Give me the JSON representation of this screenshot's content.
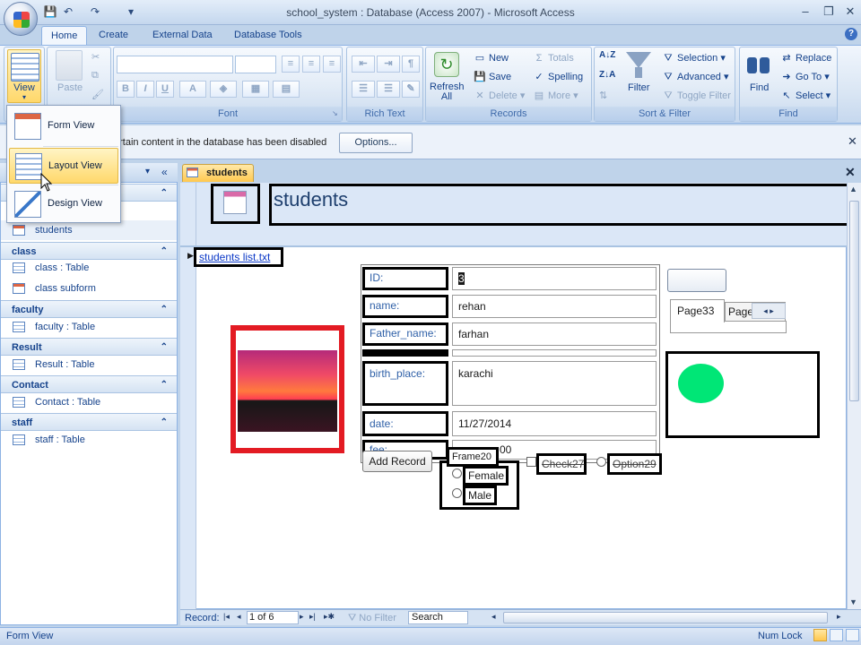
{
  "window": {
    "title": "school_system : Database (Access 2007) - Microsoft Access",
    "controls": [
      "–",
      "❐",
      "✕"
    ]
  },
  "ribbon_tabs": [
    "Home",
    "Create",
    "External Data",
    "Database Tools"
  ],
  "ribbon": {
    "views": {
      "label": "View"
    },
    "clipboard": {
      "paste": "Paste"
    },
    "font": {
      "label": "Font",
      "bold": "B",
      "italic": "I",
      "underline": "U",
      "font_color": "A"
    },
    "rich_text": {
      "label": "Rich Text"
    },
    "records": {
      "label": "Records",
      "refresh": "Refresh All",
      "new": "New",
      "save": "Save",
      "delete": "Delete",
      "totals": "Totals",
      "spelling": "Spelling",
      "more": "More"
    },
    "sort_filter": {
      "label": "Sort & Filter",
      "filter": "Filter",
      "selection": "Selection",
      "advanced": "Advanced",
      "toggle": "Toggle Filter"
    },
    "find": {
      "label": "Find",
      "find": "Find",
      "replace": "Replace",
      "goto": "Go To",
      "select": "Select"
    }
  },
  "message_bar": {
    "text": "ertain content in the database has been disabled",
    "options": "Options..."
  },
  "view_menu": {
    "items": [
      "Form View",
      "Layout View",
      "Design View"
    ],
    "highlighted": "Layout View"
  },
  "nav_pane": {
    "groups": [
      {
        "name": "",
        "items": [
          {
            "label": "students",
            "type": "form"
          }
        ]
      },
      {
        "name": "class",
        "items": [
          {
            "label": "class : Table",
            "type": "table"
          },
          {
            "label": "class subform",
            "type": "form"
          }
        ]
      },
      {
        "name": "faculty",
        "items": [
          {
            "label": "faculty : Table",
            "type": "table"
          }
        ]
      },
      {
        "name": "Result",
        "items": [
          {
            "label": "Result : Table",
            "type": "table"
          }
        ]
      },
      {
        "name": "Contact",
        "items": [
          {
            "label": "Contact : Table",
            "type": "table"
          }
        ]
      },
      {
        "name": "staff",
        "items": [
          {
            "label": "staff : Table",
            "type": "table"
          }
        ]
      }
    ]
  },
  "document": {
    "tab": "students",
    "form_title": "students",
    "hyperlink": "students list.txt",
    "fields": [
      {
        "label": "ID:",
        "value": "3"
      },
      {
        "label": "name:",
        "value": "rehan"
      },
      {
        "label": "Father_name:",
        "value": "farhan"
      },
      {
        "label": "birth_place:",
        "value": "karachi"
      },
      {
        "label": "date:",
        "value": "11/27/2014"
      },
      {
        "label": "fee:",
        "value": "00"
      }
    ],
    "add_record": "Add Record",
    "frame": "Frame20",
    "options": [
      "Female",
      "Male"
    ],
    "check": "Check27",
    "option": "Option29",
    "tab_pages": [
      "Page33",
      "Page"
    ]
  },
  "record_nav": {
    "label": "Record:",
    "position": "1 of 6",
    "filter": "No Filter",
    "search": "Search"
  },
  "status": {
    "left": "Form View",
    "num_lock": "Num Lock"
  },
  "colors": {
    "accent": "#15428b",
    "active_tab": "#ffc84f",
    "image_frame": "#e31b23",
    "circle": "#00e676"
  }
}
